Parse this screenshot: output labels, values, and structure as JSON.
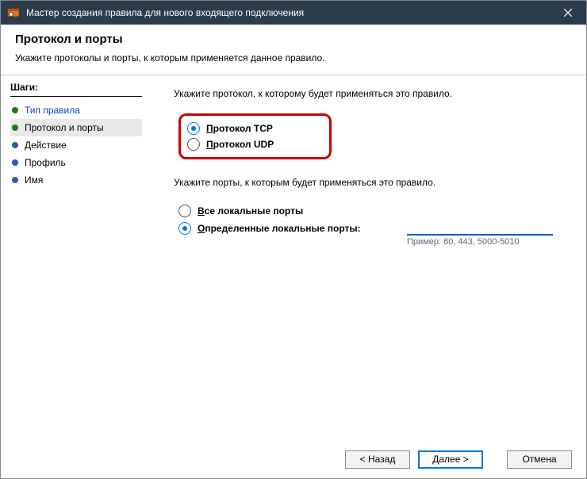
{
  "window": {
    "title": "Мастер создания правила для нового входящего подключения"
  },
  "header": {
    "title": "Протокол и порты",
    "subtitle": "Укажите протоколы и порты, к которым применяется данное правило."
  },
  "sidebar": {
    "title": "Шаги:",
    "items": [
      {
        "label": "Тип правила",
        "state": "done"
      },
      {
        "label": "Протокол и порты",
        "state": "current"
      },
      {
        "label": "Действие",
        "state": "pending"
      },
      {
        "label": "Профиль",
        "state": "pending"
      },
      {
        "label": "Имя",
        "state": "pending"
      }
    ]
  },
  "content": {
    "protocol_instruction": "Укажите протокол, к которому будет применяться это правило.",
    "protocol_tcp_prefix": "П",
    "protocol_tcp_rest": "ротокол TCP",
    "protocol_udp_prefix": "П",
    "protocol_udp_rest": "ротокол UDP",
    "ports_instruction": "Укажите порты, к которым будет применяться это правило.",
    "ports_all_prefix": "В",
    "ports_all_rest": "се локальные порты",
    "ports_specific_prefix": "О",
    "ports_specific_rest": "пределенные локальные порты:",
    "ports_value": "",
    "ports_hint": "Пример: 80, 443, 5000-5010"
  },
  "footer": {
    "back": "< Назад",
    "next": "Далее >",
    "cancel": "Отмена"
  }
}
